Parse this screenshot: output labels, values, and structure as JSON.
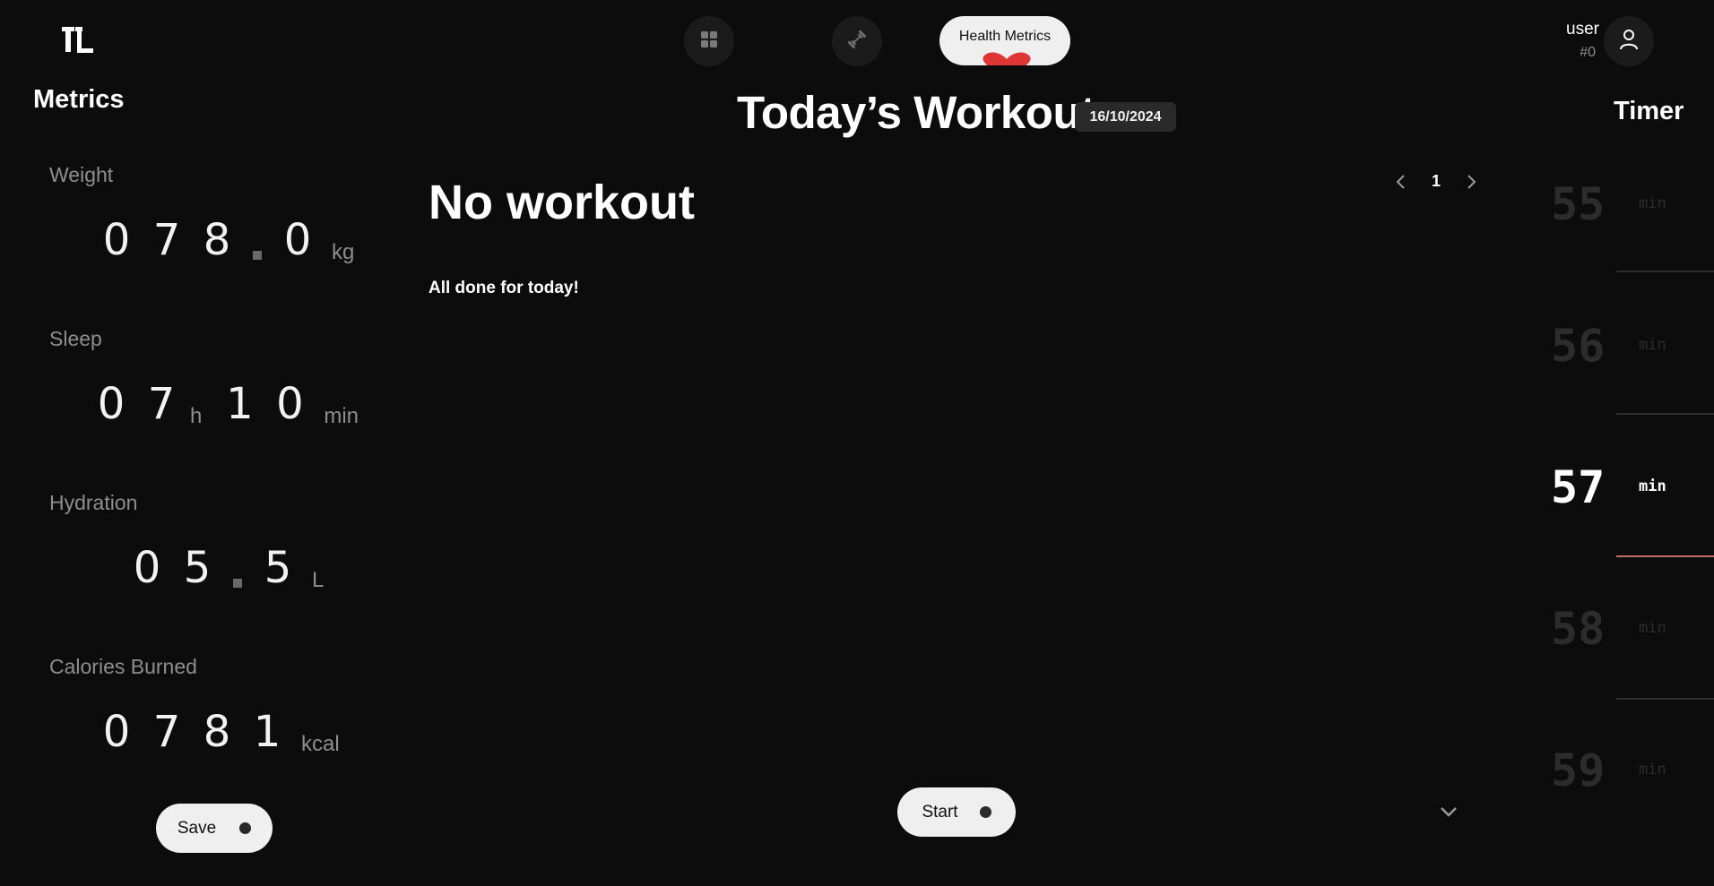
{
  "nav": {
    "health_label": "Health Metrics"
  },
  "user": {
    "name": "user",
    "id": "#0"
  },
  "metrics": {
    "title": "Metrics",
    "weight": {
      "label": "Weight",
      "digits": [
        "0",
        "7",
        "8",
        "0"
      ],
      "unit": "kg"
    },
    "sleep": {
      "label": "Sleep",
      "hours": [
        "0",
        "7"
      ],
      "hours_unit": "h",
      "minutes": [
        "1",
        "0"
      ],
      "minutes_unit": "min"
    },
    "hydration": {
      "label": "Hydration",
      "digits": [
        "0",
        "5",
        "5"
      ],
      "unit": "L"
    },
    "calories": {
      "label": "Calories Burned",
      "digits": [
        "0",
        "7",
        "8",
        "1"
      ],
      "unit": "kcal"
    },
    "save_label": "Save"
  },
  "workout": {
    "heading": "Today’s Workout",
    "date": "16/10/2024",
    "title": "No workout",
    "subtitle": "All done for today!",
    "page": "1",
    "start_label": "Start"
  },
  "timer": {
    "title": "Timer",
    "values": [
      "55",
      "56",
      "57",
      "58",
      "59"
    ],
    "unit": "min",
    "selected": "57"
  },
  "colors": {
    "background": "#0c0c0c",
    "accent_red": "#e03535",
    "button_bg": "#efefef"
  }
}
